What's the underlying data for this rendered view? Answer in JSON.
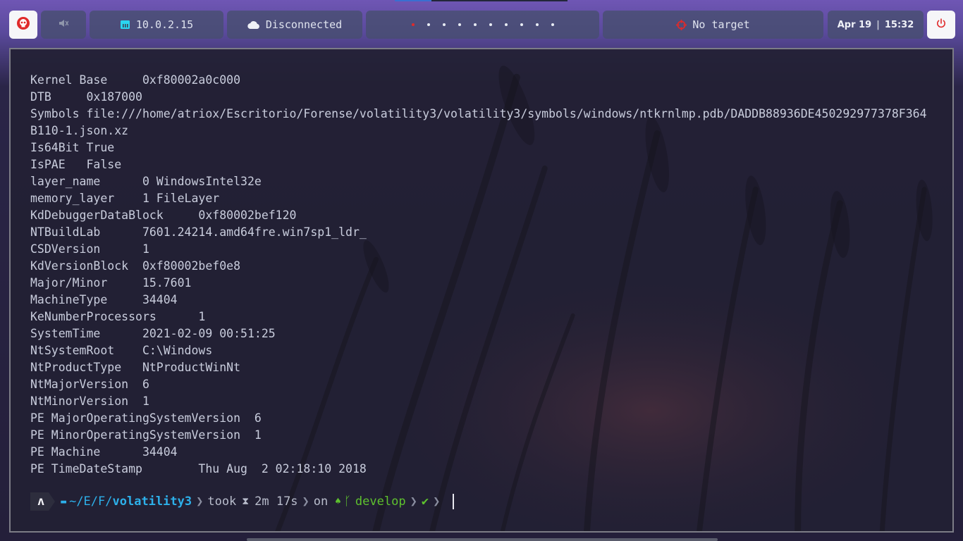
{
  "topbar": {
    "ip": "10.0.2.15",
    "vpn_status": "Disconnected",
    "target": "No target",
    "date": "Apr 19",
    "time": "15:32",
    "workspaces": [
      "active",
      "inactive",
      "inactive",
      "inactive",
      "inactive",
      "inactive",
      "inactive",
      "inactive",
      "inactive",
      "inactive"
    ],
    "icons": {
      "launcher": "skull-icon",
      "audio": "muted-speaker-icon",
      "network": "ethernet-icon",
      "vpn": "cloud-icon",
      "target": "crosshair-icon",
      "power": "power-icon"
    },
    "colors": {
      "accent": "#e02a2a",
      "ip_icon": "#2ad5f0"
    }
  },
  "terminal": {
    "lines": [
      "Kernel Base     0xf80002a0c000",
      "DTB     0x187000",
      "Symbols file:///home/atriox/Escritorio/Forense/volatility3/volatility3/symbols/windows/ntkrnlmp.pdb/DADDB88936DE450292977378F364",
      "B110-1.json.xz",
      "Is64Bit True",
      "IsPAE   False",
      "layer_name      0 WindowsIntel32e",
      "memory_layer    1 FileLayer",
      "KdDebuggerDataBlock     0xf80002bef120",
      "NTBuildLab      7601.24214.amd64fre.win7sp1_ldr_",
      "CSDVersion      1",
      "KdVersionBlock  0xf80002bef0e8",
      "Major/Minor     15.7601",
      "MachineType     34404",
      "KeNumberProcessors      1",
      "SystemTime      2021-02-09 00:51:25",
      "NtSystemRoot    C:\\Windows",
      "NtProductType   NtProductWinNt",
      "NtMajorVersion  6",
      "NtMinorVersion  1",
      "PE MajorOperatingSystemVersion  6",
      "PE MinorOperatingSystemVersion  1",
      "PE Machine      34404",
      "PE TimeDateStamp        Thu Aug  2 02:18:10 2018"
    ],
    "prompt": {
      "os_glyph": "ʌ",
      "path_prefix": "~/E/F/",
      "path_dir": "volatility3",
      "took_label": "took",
      "duration": "2m 17s",
      "on_label": "on",
      "branch": "develop",
      "status": "✔"
    }
  }
}
